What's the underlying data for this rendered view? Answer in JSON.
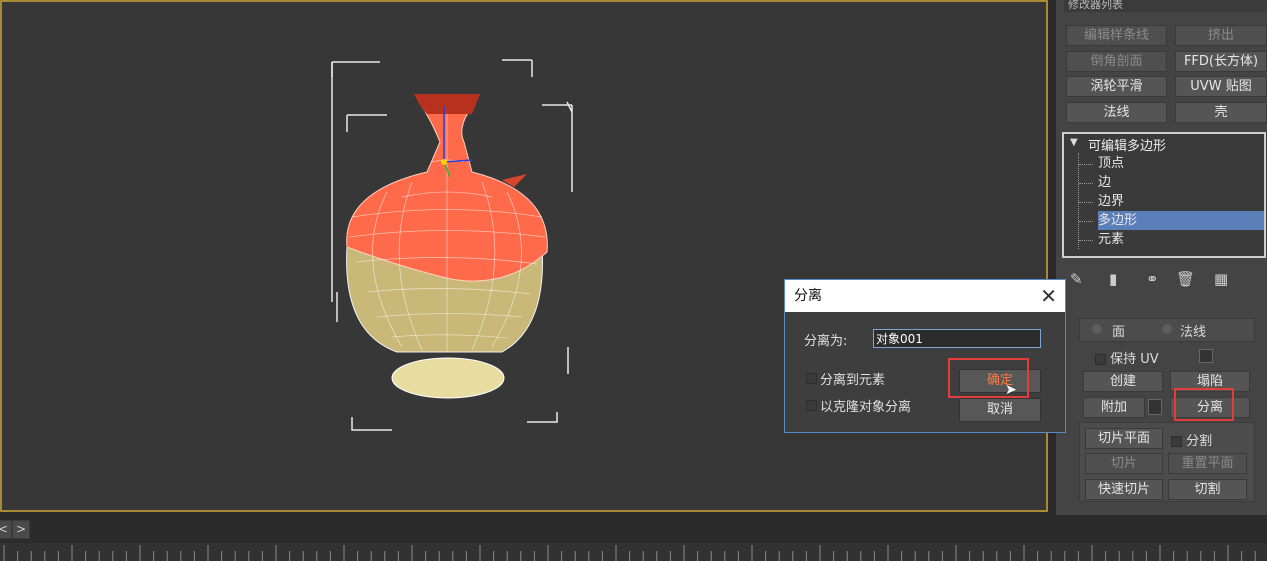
{
  "modifier_list": {
    "label": "修改器列表"
  },
  "modifier_buttons": [
    {
      "label": "编辑样条线",
      "enabled": false
    },
    {
      "label": "挤出",
      "enabled": false
    },
    {
      "label": "倒角剖面",
      "enabled": false
    },
    {
      "label": "FFD(长方体)",
      "enabled": true
    },
    {
      "label": "涡轮平滑",
      "enabled": true
    },
    {
      "label": "UVW 贴图",
      "enabled": true
    },
    {
      "label": "法线",
      "enabled": true
    },
    {
      "label": "壳",
      "enabled": true
    }
  ],
  "stack": {
    "title": "可编辑多边形",
    "items": [
      "顶点",
      "边",
      "边界",
      "多边形",
      "元素"
    ],
    "selected": "多边形"
  },
  "geometry_rollout": {
    "face_label": "面",
    "normal_label": "法线",
    "preserve_uv": "保持 UV",
    "create": "创建",
    "collapse": "塌陷",
    "attach": "附加",
    "detach": "分离",
    "slice_plane": "切片平面",
    "split": "分割",
    "slice": "切片",
    "reset_plane": "重置平面",
    "quick_slice": "快速切片",
    "cut": "切割"
  },
  "dialog": {
    "title": "分离",
    "close_glyph": "✕",
    "detach_as_label": "分离为:",
    "detach_as_value": "对象001",
    "option_to_element": "分离到元素",
    "option_as_clone": "以克隆对象分离",
    "ok": "确定",
    "cancel": "取消"
  },
  "timeline": {
    "next_glyph": ">",
    "prev_glyph": "<"
  },
  "colors": {
    "accent_border": "#a98932",
    "selection": "#5a7fb8",
    "highlight": "#e23c3c",
    "vase_top": "#ff6a4a",
    "vase_bottom": "#c9b878"
  }
}
